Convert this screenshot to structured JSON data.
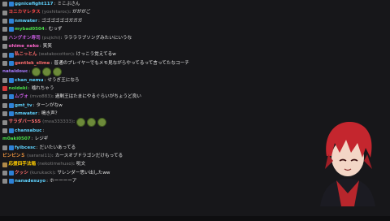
{
  "chat": {
    "messages": [
      {
        "user": "ggnicefight117",
        "sub": "",
        "text": "ミこぶさん",
        "color": "#5fd3ff",
        "badges": [
          "gray",
          "blue"
        ]
      },
      {
        "user": "ヨニカマレタス",
        "sub": "(yoshitaroc)",
        "text": "がががご",
        "color": "#ff4b4b",
        "badges": [
          "gray"
        ]
      },
      {
        "user": "nmwater",
        "sub": "",
        "text": "ゴゴゴゴゴゴガガガ",
        "color": "#5fd3ff",
        "badges": [
          "gray",
          "blue"
        ]
      },
      {
        "user": "mybad0504",
        "sub": "",
        "text": "むっず",
        "color": "#4adf4a",
        "badges": [
          "gray",
          "blue"
        ]
      },
      {
        "user": "ハングオン寿司",
        "sub": "(pujichi)",
        "text": "ララララブソングみたいにいうな",
        "color": "#c05ad8",
        "badges": [
          "gray"
        ]
      },
      {
        "user": "ohime_neko",
        "sub": "",
        "text": "笑笑",
        "color": "#ff66cc",
        "badges": [
          "gray"
        ]
      },
      {
        "user": "私こっとん",
        "sub": "(watakocotton)",
        "text": "けっこう覚えてるw",
        "color": "#ff6d6d",
        "badges": [
          "gray",
          "blue"
        ]
      },
      {
        "user": "gentlek_slime",
        "sub": "",
        "text": "普通のプレイヤーでもメモ見ながらやってるって言ってたなコーチ",
        "color": "#ff6d6d",
        "badges": [
          "gray",
          "blue"
        ]
      },
      {
        "user": "nataidouc",
        "sub": "",
        "text": "",
        "color": "#a97bff",
        "badges": [],
        "emotes": 3
      },
      {
        "user": "chan_nemu",
        "sub": "",
        "text": "せうぎ王になろ",
        "color": "#5fd3ff",
        "badges": [
          "gray",
          "blue"
        ]
      },
      {
        "user": "noideki",
        "sub": "",
        "text": "噛れちゃう",
        "color": "#4adf4a",
        "badges": [
          "red"
        ]
      },
      {
        "user": "ムヴォ",
        "sub": "(mvo883)",
        "text": "過剰王はたまにやるぐらいがちょうど良い",
        "color": "#c05ad8",
        "badges": [
          "gray",
          "blue"
        ]
      },
      {
        "user": "gmt_tv",
        "sub": "",
        "text": "ターンがなw",
        "color": "#5fd3ff",
        "badges": [
          "gray",
          "blue"
        ]
      },
      {
        "user": "nmwater",
        "sub": "",
        "text": "鳴き声？",
        "color": "#5fd3ff",
        "badges": [
          "gray",
          "blue"
        ]
      },
      {
        "user": "サラダバー555",
        "sub": "(mva333333)",
        "text": "",
        "color": "#ff6d6d",
        "badges": [
          "gray"
        ],
        "emotes": 3
      },
      {
        "user": "chansabuc",
        "sub": "",
        "text": "",
        "color": "#5fd3ff",
        "badges": [
          "gray",
          "blue"
        ]
      },
      {
        "user": "m0aki0507",
        "sub": "",
        "text": "レジギ",
        "color": "#4adf4a",
        "badges": []
      },
      {
        "user": "fyibcesc",
        "sub": "",
        "text": "だいたいあってる",
        "color": "#5fd3ff",
        "badges": [
          "gray",
          "blue"
        ]
      },
      {
        "user": "ビンビンＳ",
        "sub": "(sararai11)",
        "text": "カースオブドラゴンだけもってる",
        "color": "#ff9f43",
        "badges": []
      },
      {
        "user": "応援四手法箱",
        "sub": "(nekotimehuso)",
        "text": "呪文",
        "color": "#ffcc00",
        "badges": [
          "tan"
        ]
      },
      {
        "user": "クッシ",
        "sub": "(kurukack)",
        "text": "サレンダー思い出したww",
        "color": "#ff6d6d",
        "badges": [
          "gray",
          "blue"
        ]
      },
      {
        "user": "nanadesuyo",
        "sub": "",
        "text": "ホーーーーア",
        "color": "#5fd3ff",
        "badges": [
          "gray",
          "blue"
        ]
      }
    ]
  },
  "colors": {
    "background": "#17171a",
    "text": "#e6e6e6",
    "sub": "#7a7a7a"
  }
}
